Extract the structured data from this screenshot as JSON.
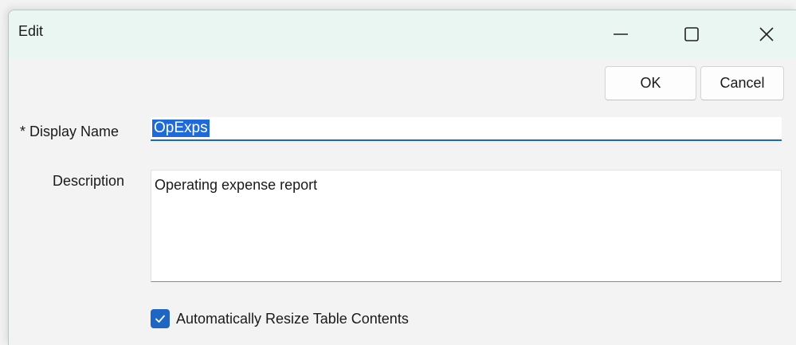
{
  "window": {
    "title": "Edit"
  },
  "title_bar_controls": {
    "minimize_icon": "minimize-icon",
    "maximize_icon": "maximize-icon",
    "close_icon": "close-icon"
  },
  "toolbar": {
    "ok_label": "OK",
    "cancel_label": "Cancel"
  },
  "form": {
    "display_name_label": "* Display Name",
    "display_name_value": "OpExps",
    "description_label": "Description",
    "description_value": "Operating expense report",
    "auto_resize_label": "Automatically Resize Table Contents",
    "auto_resize_checked": true
  },
  "colors": {
    "accent": "#1f65c4",
    "selection": "#1e6ad8",
    "titlebar_bg": "#eaf6f1"
  }
}
